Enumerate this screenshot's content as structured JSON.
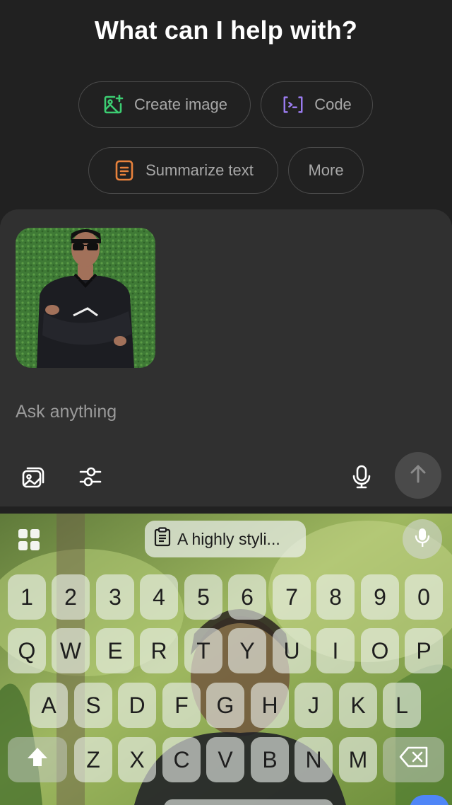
{
  "header": {
    "title": "What can I help with?"
  },
  "suggestions": {
    "create_image": {
      "label": "Create image",
      "icon": "image-sparkle-icon",
      "color": "#3ccd72"
    },
    "code": {
      "label": "Code",
      "icon": "code-bracket-icon",
      "color": "#9b7cf0"
    },
    "summarize": {
      "label": "Summarize text",
      "icon": "document-icon",
      "color": "#e8823c"
    },
    "more": {
      "label": "More"
    }
  },
  "composer": {
    "placeholder": "Ask anything",
    "attachment": {
      "alt": "Attached photo of a person in a black shirt with sunglasses against a green hedge"
    },
    "tools": [
      "attach-image-icon",
      "settings-sliders-icon",
      "microphone-icon",
      "send-arrow-icon"
    ]
  },
  "keyboard": {
    "clipboard_text": "A highly styli...",
    "rows": {
      "numbers": [
        "1",
        "2",
        "3",
        "4",
        "5",
        "6",
        "7",
        "8",
        "9",
        "0"
      ],
      "row1": [
        "Q",
        "W",
        "E",
        "R",
        "T",
        "Y",
        "U",
        "I",
        "O",
        "P"
      ],
      "row2": [
        "A",
        "S",
        "D",
        "F",
        "G",
        "H",
        "J",
        "K",
        "L"
      ],
      "row3": [
        "Z",
        "X",
        "C",
        "V",
        "B",
        "N",
        "M"
      ]
    }
  }
}
